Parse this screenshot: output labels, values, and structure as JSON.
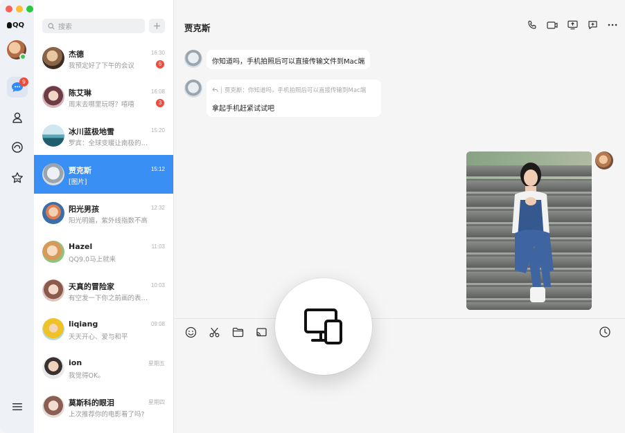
{
  "app": {
    "logo_text": "QQ",
    "rail_badge": "9"
  },
  "search": {
    "placeholder": "搜索"
  },
  "conversations": [
    {
      "name": "杰德",
      "preview": "我预定好了下午的会议",
      "time": "16:30",
      "badge": "6"
    },
    {
      "name": "陈艾琳",
      "preview": "周末去哪里玩呀？嘻嘻",
      "time": "16:08",
      "badge": "3"
    },
    {
      "name": "冰川蓝极地雪",
      "preview": "罗宾：全球变暖让南极的冰…",
      "time": "15:20",
      "badge": ""
    },
    {
      "name": "贾克斯",
      "preview": "[图片]",
      "time": "15:12",
      "badge": ""
    },
    {
      "name": "阳光男孩",
      "preview": "阳光明媚，紫外线指数不高",
      "time": "12:32",
      "badge": ""
    },
    {
      "name": "Hazel",
      "preview": "QQ9.0马上就来",
      "time": "11:03",
      "badge": ""
    },
    {
      "name": "天真的冒险家",
      "preview": "有空发一下你之前画的表情…",
      "time": "10:03",
      "badge": ""
    },
    {
      "name": "liqiang",
      "preview": "天天开心、爱与和平",
      "time": "09:08",
      "badge": ""
    },
    {
      "name": "ion",
      "preview": "我觉得OK。",
      "time": "星期五",
      "badge": ""
    },
    {
      "name": "莫斯科的眼泪",
      "preview": "上次推荐你的电影看了吗?",
      "time": "星期四",
      "badge": ""
    }
  ],
  "chat": {
    "title": "贾克斯",
    "message1": "你知道吗，手机拍照后可以直接传输文件到Mac端",
    "quote": "贾克斯：你知道吗，手机拍照后可以直接传输到Mac端",
    "reply": "拿起手机赶紧试试吧"
  },
  "icons": {
    "top": [
      "phone-icon",
      "video-call-icon",
      "screen-share-icon",
      "add-chat-icon",
      "more-icon"
    ],
    "bottom": [
      "emoji-icon",
      "scissors-icon",
      "folder-icon",
      "screen-cast-icon",
      "history-icon"
    ],
    "overlay": "multi-device-icon"
  },
  "colors": {
    "accent": "#3a8ff5",
    "badge": "#ef4b3c",
    "online": "#35c759"
  }
}
